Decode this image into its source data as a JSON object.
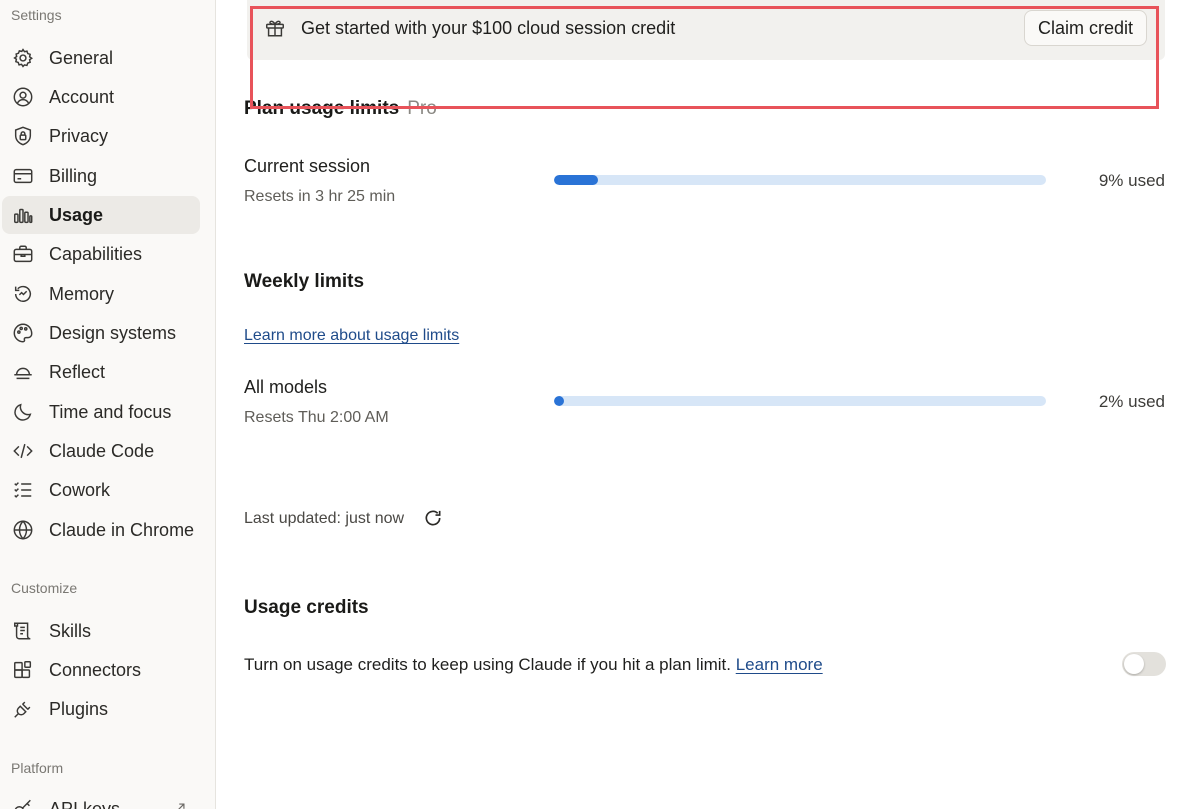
{
  "sidebar": {
    "sections": [
      {
        "label": "Settings",
        "items": [
          {
            "label": "General",
            "icon": "gear-icon"
          },
          {
            "label": "Account",
            "icon": "user-circle-icon"
          },
          {
            "label": "Privacy",
            "icon": "shield-lock-icon"
          },
          {
            "label": "Billing",
            "icon": "credit-card-icon"
          },
          {
            "label": "Usage",
            "icon": "bar-chart-icon",
            "active": true
          },
          {
            "label": "Capabilities",
            "icon": "toolbox-icon"
          },
          {
            "label": "Memory",
            "icon": "memory-icon"
          },
          {
            "label": "Design systems",
            "icon": "palette-icon"
          },
          {
            "label": "Reflect",
            "icon": "sunset-icon"
          },
          {
            "label": "Time and focus",
            "icon": "moon-icon"
          },
          {
            "label": "Claude Code",
            "icon": "code-icon"
          },
          {
            "label": "Cowork",
            "icon": "checklist-icon"
          },
          {
            "label": "Claude in Chrome",
            "icon": "globe-icon"
          }
        ]
      },
      {
        "label": "Customize",
        "items": [
          {
            "label": "Skills",
            "icon": "scroll-icon"
          },
          {
            "label": "Connectors",
            "icon": "blocks-icon"
          },
          {
            "label": "Plugins",
            "icon": "plug-icon"
          }
        ]
      },
      {
        "label": "Platform",
        "items": [
          {
            "label": "API keys",
            "icon": "key-icon",
            "external": true
          }
        ]
      }
    ]
  },
  "banner": {
    "text": "Get started with your $100 cloud session credit",
    "button": "Claim credit",
    "icon": "gift-icon",
    "highlight_color": "#e8535a"
  },
  "plan": {
    "title": "Plan usage limits",
    "tier": "Pro",
    "current_session": {
      "title": "Current session",
      "resets": "Resets in 3 hr 25 min",
      "percent": 9,
      "used_label": "9% used"
    }
  },
  "weekly": {
    "title": "Weekly limits",
    "learn_more": "Learn more about usage limits",
    "all_models": {
      "title": "All models",
      "resets": "Resets Thu 2:00 AM",
      "percent": 2,
      "used_label": "2% used"
    }
  },
  "last_updated": "Last updated: just now",
  "credits": {
    "title": "Usage credits",
    "description": "Turn on usage credits to keep using Claude if you hit a plan limit.",
    "link": "Learn more",
    "toggle_on": false
  },
  "colors": {
    "accent": "#2a73d6",
    "bar_track": "#d7e6f7",
    "link": "#1f4b8a"
  }
}
